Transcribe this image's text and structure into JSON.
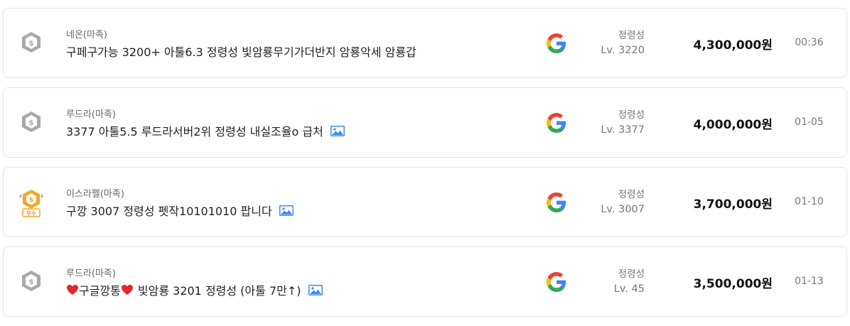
{
  "listings": [
    {
      "badge": "grey-shield",
      "server": "네온(마족)",
      "title": "구페구가능 3200+ 아툴6.3 정령성 빛암룡무기가더반지 암룡악세 암룡갑",
      "has_image": false,
      "platform_icon": "google-icon",
      "job": "정령성",
      "level": "Lv. 3220",
      "price": "4,300,000원",
      "date": "00:36"
    },
    {
      "badge": "grey-shield",
      "server": "루드라(마족)",
      "title": "3377 아툴5.5 루드라서버2위 정령성 내실조율o 급처",
      "has_image": true,
      "platform_icon": "google-icon",
      "job": "정령성",
      "level": "Lv. 3377",
      "price": "4,000,000원",
      "date": "01-05"
    },
    {
      "badge": "gold-shield",
      "badge_label": "우수",
      "server": "이스라펠(마족)",
      "title": "구깡 3007 정령성 펫작10101010 팝니다",
      "has_image": true,
      "platform_icon": "google-icon",
      "job": "정령성",
      "level": "Lv. 3007",
      "price": "3,700,000원",
      "date": "01-10"
    },
    {
      "badge": "grey-shield",
      "server": "루드라(마족)",
      "title_parts": [
        "구글깡통",
        "빛암룡 3201 정령성 (아툴 7만↑)"
      ],
      "has_image": true,
      "platform_icon": "google-icon",
      "job": "정령성",
      "level": "Lv. 45",
      "price": "3,500,000원",
      "date": "01-13"
    }
  ],
  "colors": {
    "grey_badge": "#a9a9a9",
    "gold_badge": "#f5a623",
    "heart": "#e3262e",
    "image_icon": "#3d8ee8"
  }
}
